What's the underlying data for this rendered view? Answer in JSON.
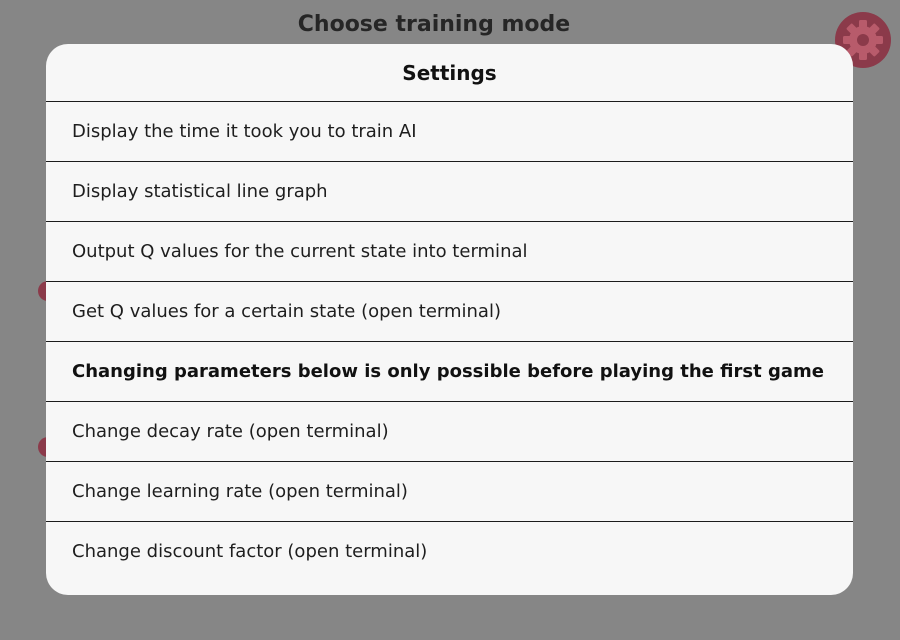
{
  "background": {
    "title": "Choose training mode",
    "accent_color": "#8b3a4a"
  },
  "settings_modal": {
    "title": "Settings",
    "items": [
      {
        "label": "Display the time it took you to train AI",
        "interactable": true
      },
      {
        "label": "Display statistical line graph",
        "interactable": true
      },
      {
        "label": "Output Q values for the current state into terminal",
        "interactable": true
      },
      {
        "label": "Get Q values for a certain state (open terminal)",
        "interactable": true
      },
      {
        "label": "Changing parameters below is only possible before playing the first game",
        "interactable": false
      },
      {
        "label": "Change decay rate (open terminal)",
        "interactable": true
      },
      {
        "label": "Change learning rate (open terminal)",
        "interactable": true
      },
      {
        "label": "Change discount factor (open terminal)",
        "interactable": true
      }
    ]
  },
  "icons": {
    "settings": "gear-icon"
  }
}
